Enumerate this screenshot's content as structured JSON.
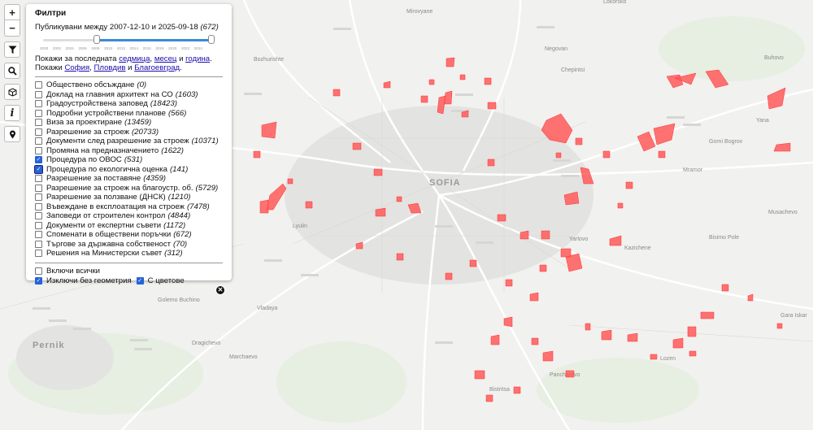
{
  "toolbar": {
    "zoom_in": "+",
    "zoom_out": "−"
  },
  "filters": {
    "title": "Филтри",
    "range_prefix": "Публикувани между 2007-12-10 и 2025-09-18",
    "range_count": "(672)",
    "slider_ticks": [
      "2000",
      "2002",
      "2004",
      "2006",
      "2008",
      "2010",
      "2012",
      "2014",
      "2016",
      "2018",
      "2020",
      "2022",
      "2024"
    ],
    "quick_prefix": "Покажи за последната",
    "quick_week": "седмица",
    "quick_comma": ",",
    "quick_month": "месец",
    "quick_and": "и",
    "quick_year": "година",
    "quick_dot": ".",
    "city_prefix": "Покажи",
    "city_sofia": "София",
    "city_plovdiv": "Пловдив",
    "city_and": "и",
    "city_blagoevgrad": "Благоевград",
    "categories": [
      {
        "label": "Обществено обсъждане",
        "count": "(0)",
        "checked": false
      },
      {
        "label": "Доклад на главния архитект на СО",
        "count": "(1603)",
        "checked": false
      },
      {
        "label": "Градоустройствена заповед",
        "count": "(18423)",
        "checked": false
      },
      {
        "label": "Подробни устройствени планове",
        "count": "(566)",
        "checked": false
      },
      {
        "label": "Виза за проектиране",
        "count": "(13459)",
        "checked": false
      },
      {
        "label": "Разрешение за строеж",
        "count": "(20733)",
        "checked": false
      },
      {
        "label": "Документи след разрешение за строеж",
        "count": "(10371)",
        "checked": false
      },
      {
        "label": "Промяна на предназначението",
        "count": "(1622)",
        "checked": false
      },
      {
        "label": "Процедура по ОВОС",
        "count": "(531)",
        "checked": true
      },
      {
        "label": "Процедура по екологична оценка",
        "count": "(141)",
        "checked": true
      },
      {
        "label": "Разрешение за поставяне",
        "count": "(4359)",
        "checked": false
      },
      {
        "label": "Разрешение за строеж на благоустр. об.",
        "count": "(5729)",
        "checked": false
      },
      {
        "label": "Разрешение за ползване (ДНСК)",
        "count": "(1210)",
        "checked": false
      },
      {
        "label": "Въвеждане в експлоатация на строеж",
        "count": "(7478)",
        "checked": false
      },
      {
        "label": "Заповеди от строителен контрол",
        "count": "(4844)",
        "checked": false
      },
      {
        "label": "Документи от експертни съвети",
        "count": "(1172)",
        "checked": false
      },
      {
        "label": "Споменати в обществени поръчки",
        "count": "(672)",
        "checked": false
      },
      {
        "label": "Търгове за държавна собственост",
        "count": "(70)",
        "checked": false
      },
      {
        "label": "Решения на Министерски съвет",
        "count": "(312)",
        "checked": false
      }
    ],
    "include_all": "Включи всички",
    "exclude_no_geom": "Изключи без геометрия",
    "with_colors": "С цветове"
  },
  "map": {
    "places": [
      {
        "label": "Lokorsko",
        "cls": ""
      },
      {
        "label": "Mirovyane",
        "cls": ""
      },
      {
        "label": "Negovan",
        "cls": ""
      },
      {
        "label": "Chepintsi",
        "cls": ""
      },
      {
        "label": "Buhovo",
        "cls": ""
      },
      {
        "label": "Bozhurishte",
        "cls": ""
      },
      {
        "label": "Gorni Bogrov",
        "cls": ""
      },
      {
        "label": "Yana",
        "cls": ""
      },
      {
        "label": "SOFIA",
        "cls": "big"
      },
      {
        "label": "Mramor",
        "cls": ""
      },
      {
        "label": "Musachevo",
        "cls": ""
      },
      {
        "label": "Yarlovo",
        "cls": ""
      },
      {
        "label": "Kazichene",
        "cls": ""
      },
      {
        "label": "Bisimo Pole",
        "cls": ""
      },
      {
        "label": "Pernik",
        "cls": "big"
      },
      {
        "label": "Golemo Buchino",
        "cls": ""
      },
      {
        "label": "Vladaya",
        "cls": ""
      },
      {
        "label": "Dragichevo",
        "cls": ""
      },
      {
        "label": "Marchaevo",
        "cls": ""
      },
      {
        "label": "Bistritsa",
        "cls": ""
      },
      {
        "label": "Pancharevo",
        "cls": ""
      },
      {
        "label": "Lozen",
        "cls": ""
      },
      {
        "label": "Gara Iskar",
        "cls": ""
      },
      {
        "label": "Lyulin",
        "cls": ""
      }
    ]
  },
  "colors": {
    "polygon": "#ff5a5a",
    "accent": "#3b8ad8",
    "link": "#1a0dab"
  }
}
